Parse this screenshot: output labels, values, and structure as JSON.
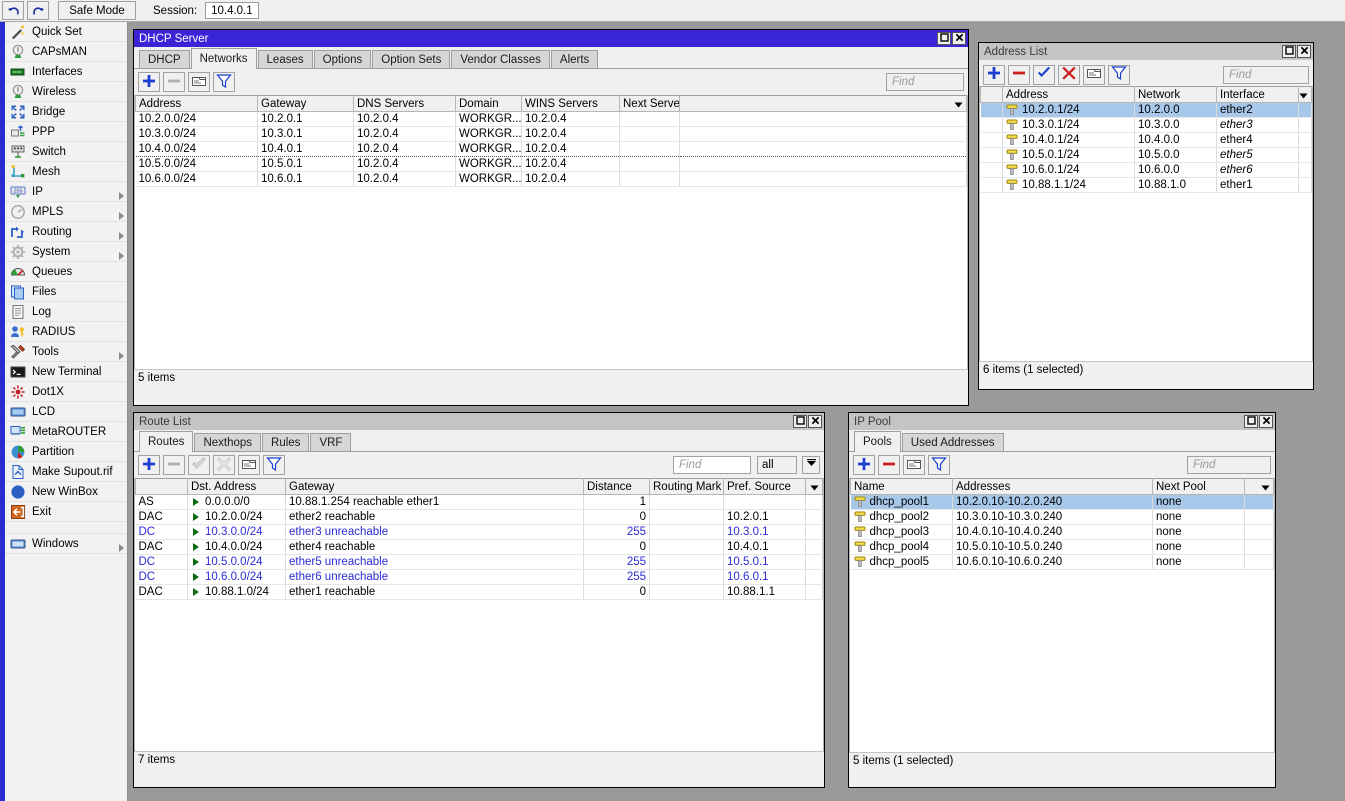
{
  "topbar": {
    "undo_icon": "undo-arrow-icon",
    "redo_icon": "redo-arrow-icon",
    "safe_mode_label": "Safe Mode",
    "session_label": "Session:",
    "session_value": "10.4.0.1"
  },
  "sidebar": {
    "items": [
      {
        "label": "Quick Set",
        "icon": "wand-icon",
        "arrow": false
      },
      {
        "label": "CAPsMAN",
        "icon": "antenna-icon",
        "arrow": false
      },
      {
        "label": "Interfaces",
        "icon": "interface-icon",
        "arrow": false
      },
      {
        "label": "Wireless",
        "icon": "antenna-icon",
        "arrow": false
      },
      {
        "label": "Bridge",
        "icon": "bridge-icon",
        "arrow": false
      },
      {
        "label": "PPP",
        "icon": "ppp-icon",
        "arrow": false
      },
      {
        "label": "Switch",
        "icon": "switch-icon",
        "arrow": false
      },
      {
        "label": "Mesh",
        "icon": "mesh-icon",
        "arrow": false
      },
      {
        "label": "IP",
        "icon": "ip-255-icon",
        "arrow": true
      },
      {
        "label": "MPLS",
        "icon": "mpls-icon",
        "arrow": true
      },
      {
        "label": "Routing",
        "icon": "routing-icon",
        "arrow": true
      },
      {
        "label": "System",
        "icon": "gear-icon",
        "arrow": true
      },
      {
        "label": "Queues",
        "icon": "queues-icon",
        "arrow": false
      },
      {
        "label": "Files",
        "icon": "files-icon",
        "arrow": false
      },
      {
        "label": "Log",
        "icon": "log-icon",
        "arrow": false
      },
      {
        "label": "RADIUS",
        "icon": "radius-icon",
        "arrow": false
      },
      {
        "label": "Tools",
        "icon": "tools-icon",
        "arrow": true
      },
      {
        "label": "New Terminal",
        "icon": "terminal-icon",
        "arrow": false
      },
      {
        "label": "Dot1X",
        "icon": "dot1x-icon",
        "arrow": false
      },
      {
        "label": "LCD",
        "icon": "lcd-icon",
        "arrow": false
      },
      {
        "label": "MetaROUTER",
        "icon": "metarouter-icon",
        "arrow": false
      },
      {
        "label": "Partition",
        "icon": "partition-icon",
        "arrow": false
      },
      {
        "label": "Make Supout.rif",
        "icon": "supout-icon",
        "arrow": false
      },
      {
        "label": "New WinBox",
        "icon": "winbox-icon",
        "arrow": false
      },
      {
        "label": "Exit",
        "icon": "exit-icon",
        "arrow": false
      }
    ],
    "windows_item": {
      "label": "Windows",
      "icon": "windows-icon",
      "arrow": true
    }
  },
  "dhcp_window": {
    "title": "DHCP Server",
    "title_active": true,
    "controls": {
      "maximize_icon": "maximize-icon",
      "close_icon": "close-icon"
    },
    "tabs": [
      {
        "label": "DHCP",
        "selected": false
      },
      {
        "label": "Networks",
        "selected": true
      },
      {
        "label": "Leases",
        "selected": false
      },
      {
        "label": "Options",
        "selected": false
      },
      {
        "label": "Option Sets",
        "selected": false
      },
      {
        "label": "Vendor Classes",
        "selected": false
      },
      {
        "label": "Alerts",
        "selected": false
      }
    ],
    "toolbar": [
      {
        "icon": "plus-icon",
        "enabled": true
      },
      {
        "icon": "minus-icon",
        "enabled": false
      },
      {
        "icon": "comment-icon",
        "enabled": true
      },
      {
        "icon": "filter-icon",
        "enabled": true
      }
    ],
    "find_placeholder": "Find",
    "columns": [
      "Address",
      "Gateway",
      "DNS Servers",
      "Domain",
      "WINS Servers",
      "Next Server",
      ""
    ],
    "sort_column": 0,
    "rows": [
      {
        "cells": [
          "10.2.0.0/24",
          "10.2.0.1",
          "10.2.0.4",
          "WORKGR...",
          "10.2.0.4",
          "",
          ""
        ],
        "selected": false,
        "dotted": false
      },
      {
        "cells": [
          "10.3.0.0/24",
          "10.3.0.1",
          "10.2.0.4",
          "WORKGR...",
          "10.2.0.4",
          "",
          ""
        ],
        "selected": false,
        "dotted": false
      },
      {
        "cells": [
          "10.4.0.0/24",
          "10.4.0.1",
          "10.2.0.4",
          "WORKGR...",
          "10.2.0.4",
          "",
          ""
        ],
        "selected": false,
        "dotted": true
      },
      {
        "cells": [
          "10.5.0.0/24",
          "10.5.0.1",
          "10.2.0.4",
          "WORKGR...",
          "10.2.0.4",
          "",
          ""
        ],
        "selected": false,
        "dotted": false
      },
      {
        "cells": [
          "10.6.0.0/24",
          "10.6.0.1",
          "10.2.0.4",
          "WORKGR...",
          "10.2.0.4",
          "",
          ""
        ],
        "selected": false,
        "dotted": false
      }
    ],
    "status": "5 items"
  },
  "address_window": {
    "title": "Address List",
    "title_active": false,
    "controls": {
      "maximize_icon": "maximize-icon",
      "close_icon": "close-icon"
    },
    "toolbar": [
      {
        "icon": "plus-icon",
        "enabled": true
      },
      {
        "icon": "minus-icon",
        "enabled": true
      },
      {
        "icon": "check-icon",
        "enabled": true
      },
      {
        "icon": "cross-icon",
        "enabled": true
      },
      {
        "icon": "comment-icon",
        "enabled": true
      },
      {
        "icon": "filter-icon",
        "enabled": true
      }
    ],
    "find_placeholder": "Find",
    "columns": [
      "",
      "Address",
      "Network",
      "Interface",
      ""
    ],
    "rows": [
      {
        "cells": [
          "10.2.0.1/24",
          "10.2.0.0",
          "ether2"
        ],
        "selected": true,
        "italic": false
      },
      {
        "cells": [
          "10.3.0.1/24",
          "10.3.0.0",
          "ether3"
        ],
        "selected": false,
        "italic": true
      },
      {
        "cells": [
          "10.4.0.1/24",
          "10.4.0.0",
          "ether4"
        ],
        "selected": false,
        "italic": false
      },
      {
        "cells": [
          "10.5.0.1/24",
          "10.5.0.0",
          "ether5"
        ],
        "selected": false,
        "italic": true
      },
      {
        "cells": [
          "10.6.0.1/24",
          "10.6.0.0",
          "ether6"
        ],
        "selected": false,
        "italic": true
      },
      {
        "cells": [
          "10.88.1.1/24",
          "10.88.1.0",
          "ether1"
        ],
        "selected": false,
        "italic": false
      }
    ],
    "status": "6 items (1 selected)"
  },
  "route_window": {
    "title": "Route List",
    "title_active": false,
    "controls": {
      "maximize_icon": "maximize-icon",
      "close_icon": "close-icon"
    },
    "tabs": [
      {
        "label": "Routes",
        "selected": true
      },
      {
        "label": "Nexthops",
        "selected": false
      },
      {
        "label": "Rules",
        "selected": false
      },
      {
        "label": "VRF",
        "selected": false
      }
    ],
    "toolbar": [
      {
        "icon": "plus-icon",
        "enabled": true
      },
      {
        "icon": "minus-icon",
        "enabled": false
      },
      {
        "icon": "check-icon",
        "enabled": false
      },
      {
        "icon": "cross-icon",
        "enabled": false
      },
      {
        "icon": "comment-icon",
        "enabled": true
      },
      {
        "icon": "filter-icon",
        "enabled": true
      }
    ],
    "find_placeholder": "Find",
    "filter_select_value": "all",
    "columns": [
      "",
      "Dst. Address",
      "Gateway",
      "Distance",
      "Routing Mark",
      "Pref. Source",
      ""
    ],
    "rows": [
      {
        "flags": "AS",
        "dst": "0.0.0.0/0",
        "gateway": "10.88.1.254 reachable ether1",
        "distance": "1",
        "routing_mark": "",
        "pref_source": "",
        "blue": false
      },
      {
        "flags": "DAC",
        "dst": "10.2.0.0/24",
        "gateway": "ether2 reachable",
        "distance": "0",
        "routing_mark": "",
        "pref_source": "10.2.0.1",
        "blue": false
      },
      {
        "flags": "DC",
        "dst": "10.3.0.0/24",
        "gateway": "ether3 unreachable",
        "distance": "255",
        "routing_mark": "",
        "pref_source": "10.3.0.1",
        "blue": true
      },
      {
        "flags": "DAC",
        "dst": "10.4.0.0/24",
        "gateway": "ether4 reachable",
        "distance": "0",
        "routing_mark": "",
        "pref_source": "10.4.0.1",
        "blue": false
      },
      {
        "flags": "DC",
        "dst": "10.5.0.0/24",
        "gateway": "ether5 unreachable",
        "distance": "255",
        "routing_mark": "",
        "pref_source": "10.5.0.1",
        "blue": true
      },
      {
        "flags": "DC",
        "dst": "10.6.0.0/24",
        "gateway": "ether6 unreachable",
        "distance": "255",
        "routing_mark": "",
        "pref_source": "10.6.0.1",
        "blue": true
      },
      {
        "flags": "DAC",
        "dst": "10.88.1.0/24",
        "gateway": "ether1 reachable",
        "distance": "0",
        "routing_mark": "",
        "pref_source": "10.88.1.1",
        "blue": false
      }
    ],
    "status": "7 items"
  },
  "pool_window": {
    "title": "IP Pool",
    "title_active": false,
    "controls": {
      "maximize_icon": "maximize-icon",
      "close_icon": "close-icon"
    },
    "tabs": [
      {
        "label": "Pools",
        "selected": true
      },
      {
        "label": "Used Addresses",
        "selected": false
      }
    ],
    "toolbar": [
      {
        "icon": "plus-icon",
        "enabled": true
      },
      {
        "icon": "minus-icon",
        "enabled": true
      },
      {
        "icon": "comment-icon",
        "enabled": true
      },
      {
        "icon": "filter-icon",
        "enabled": true
      }
    ],
    "find_placeholder": "Find",
    "columns": [
      "Name",
      "Addresses",
      "Next Pool",
      ""
    ],
    "rows": [
      {
        "cells": [
          "dhcp_pool1",
          "10.2.0.10-10.2.0.240",
          "none"
        ],
        "selected": true
      },
      {
        "cells": [
          "dhcp_pool2",
          "10.3.0.10-10.3.0.240",
          "none"
        ],
        "selected": false
      },
      {
        "cells": [
          "dhcp_pool3",
          "10.4.0.10-10.4.0.240",
          "none"
        ],
        "selected": false
      },
      {
        "cells": [
          "dhcp_pool4",
          "10.5.0.10-10.5.0.240",
          "none"
        ],
        "selected": false
      },
      {
        "cells": [
          "dhcp_pool5",
          "10.6.0.10-10.6.0.240",
          "none"
        ],
        "selected": false
      }
    ],
    "status": "5 items (1 selected)"
  },
  "colors": {
    "accent_blue": "#2b2bd4",
    "title_active": "#3a26d6",
    "title_inactive": "#c4c4c4",
    "selection": "#a8c8ea",
    "desktop": "#9a9a9a"
  }
}
